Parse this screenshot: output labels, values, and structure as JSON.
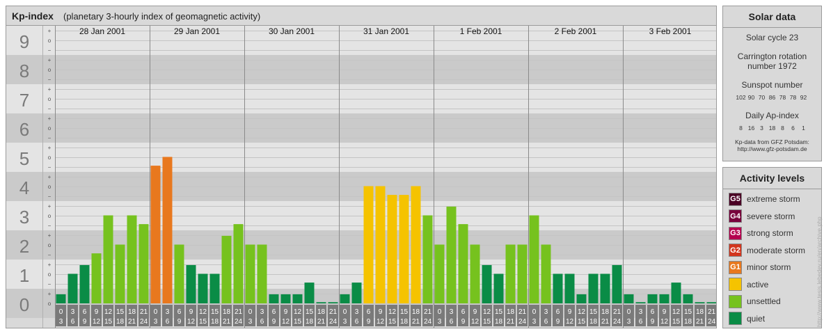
{
  "header": {
    "title": "Kp-index",
    "subtitle": "(planetary 3-hourly index of geomagnetic activity)"
  },
  "solar": {
    "title": "Solar data",
    "cycle": "Solar cycle 23",
    "carrington_line1": "Carrington rotation",
    "carrington_line2": "number 1972",
    "sunspot_title": "Sunspot number",
    "sunspot_values": [
      "102",
      "90",
      "70",
      "86",
      "78",
      "78",
      "92"
    ],
    "ap_title": "Daily Ap-index",
    "ap_values": [
      "8",
      "16",
      "3",
      "18",
      "8",
      "6",
      "1"
    ],
    "source_line1": "Kp-data from GFZ Potsdam:",
    "source_line2": "http://www.gfz-potsdam.de"
  },
  "activity": {
    "title": "Activity levels",
    "levels": [
      {
        "badge": "G5",
        "label": "extreme storm",
        "color": "#4a0024"
      },
      {
        "badge": "G4",
        "label": "severe storm",
        "color": "#78003c"
      },
      {
        "badge": "G3",
        "label": "strong storm",
        "color": "#b4004f"
      },
      {
        "badge": "G2",
        "label": "moderate storm",
        "color": "#d2361e"
      },
      {
        "badge": "G1",
        "label": "minor storm",
        "color": "#e8781e"
      },
      {
        "badge": "",
        "label": "active",
        "color": "#f5c300"
      },
      {
        "badge": "",
        "label": "unsettled",
        "color": "#76c21e"
      },
      {
        "badge": "",
        "label": "quiet",
        "color": "#0a8c46"
      }
    ]
  },
  "credit": "http://www.tesis.lebedev.ru/en/archive.php",
  "chart_data": {
    "type": "bar",
    "y_ticks": [
      "0",
      "1",
      "2",
      "3",
      "4",
      "5",
      "6",
      "7",
      "8",
      "9"
    ],
    "sub_ticks": [
      "o",
      "+",
      "−"
    ],
    "ylim": [
      0,
      9
    ],
    "days": [
      "28 Jan 2001",
      "29 Jan 2001",
      "30 Jan 2001",
      "31 Jan 2001",
      "1 Feb 2001",
      "2 Feb 2001",
      "3 Feb 2001"
    ],
    "slot_start": [
      "0",
      "3",
      "6",
      "9",
      "12",
      "15",
      "18",
      "21"
    ],
    "slot_end": [
      "3",
      "6",
      "9",
      "12",
      "15",
      "18",
      "21",
      "24"
    ],
    "kp": [
      [
        0.3,
        1.0,
        1.3,
        1.7,
        3.0,
        2.0,
        3.0,
        2.7
      ],
      [
        4.7,
        5.0,
        2.0,
        1.3,
        1.0,
        1.0,
        2.3,
        2.7
      ],
      [
        2.0,
        2.0,
        0.3,
        0.3,
        0.3,
        0.7,
        0.0,
        0.0
      ],
      [
        0.3,
        0.7,
        4.0,
        4.0,
        3.7,
        3.7,
        4.0,
        3.0
      ],
      [
        2.0,
        3.3,
        2.7,
        2.0,
        1.3,
        1.0,
        2.0,
        2.0
      ],
      [
        3.0,
        2.0,
        1.0,
        1.0,
        0.3,
        1.0,
        1.0,
        1.3
      ],
      [
        0.3,
        0.0,
        0.3,
        0.3,
        0.7,
        0.3,
        0.0,
        0.0
      ]
    ],
    "colors": {
      "quiet": "#0a8c46",
      "unsettled": "#76c21e",
      "active": "#f5c300",
      "minor_storm": "#e8781e"
    },
    "band_colors": [
      "#cacaca",
      "#e4e4e4"
    ],
    "xlabel": "",
    "ylabel": ""
  }
}
